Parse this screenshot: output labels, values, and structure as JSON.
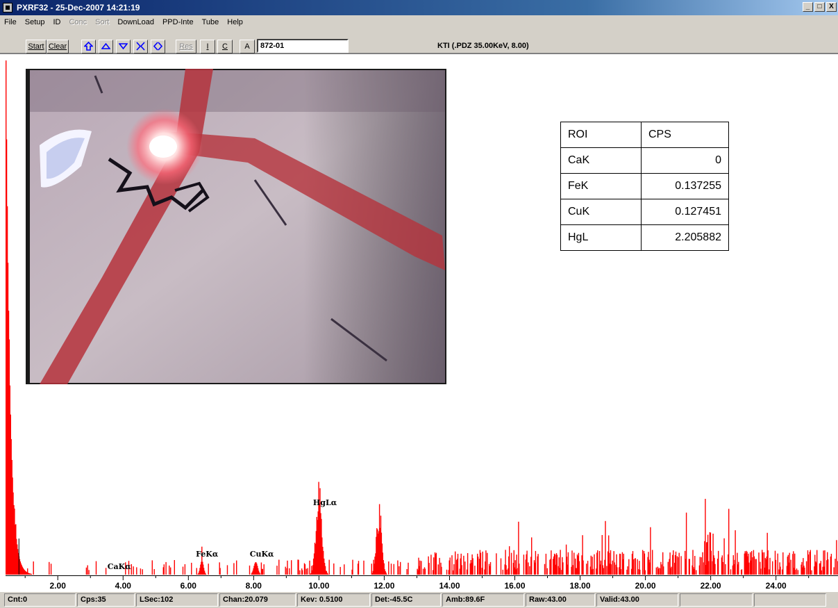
{
  "window": {
    "title": "PXRF32 - 25-Dec-2007 14:21:19",
    "controls": [
      "_",
      "□",
      "X"
    ]
  },
  "menu": [
    "File",
    "Setup",
    "ID",
    "Conc",
    "Sort",
    "DownLoad",
    "PPD-Inte",
    "Tube",
    "Help"
  ],
  "toolbar": {
    "start_label": "Start",
    "clear_label": "Clear",
    "icons": [
      "home-up-icon",
      "arrow-up-icon",
      "arrow-down-icon",
      "compress-icon",
      "expand-icon"
    ],
    "res_label": "Res",
    "i_label": "I",
    "c_label": "C",
    "a_label": "A",
    "sample_id": "872-01",
    "status": "KTI  (.PDZ 35.00KeV, 8.00)"
  },
  "roi_table": {
    "headers": [
      "ROI",
      "CPS"
    ],
    "rows": [
      [
        "CaK",
        "0"
      ],
      [
        "FeK",
        "0.137255"
      ],
      [
        "CuK",
        "0.127451"
      ],
      [
        "HgL",
        "2.205882"
      ]
    ]
  },
  "chart_data": {
    "type": "bar",
    "x_range": [
      0.4,
      25.9
    ],
    "x_ticks": [
      2,
      4,
      6,
      8,
      10,
      12,
      14,
      16,
      18,
      20,
      22,
      24
    ],
    "x_tick_labels": [
      "2.00",
      "4.00",
      "6.00",
      "8.00",
      "10.00",
      "12.00",
      "14.00",
      "16.00",
      "18.00",
      "20.00",
      "22.00",
      "24.00"
    ],
    "series_color": "#ff0000",
    "cursor_kev": 0.51,
    "peaks": [
      {
        "label": "CaKα",
        "kev": 3.69
      },
      {
        "label": "FeKα",
        "kev": 6.4
      },
      {
        "label": "CuKα",
        "kev": 8.05
      },
      {
        "label": "HgLα",
        "kev": 9.99
      }
    ]
  },
  "statusbar": [
    "Cnt:0",
    "Cps:35",
    "LSec:102",
    "Chan:20.079",
    "Kev: 0.5100",
    "Det:-45.5C",
    "Amb:89.6F",
    "Raw:43.00",
    "Valid:43.00",
    "",
    ""
  ]
}
